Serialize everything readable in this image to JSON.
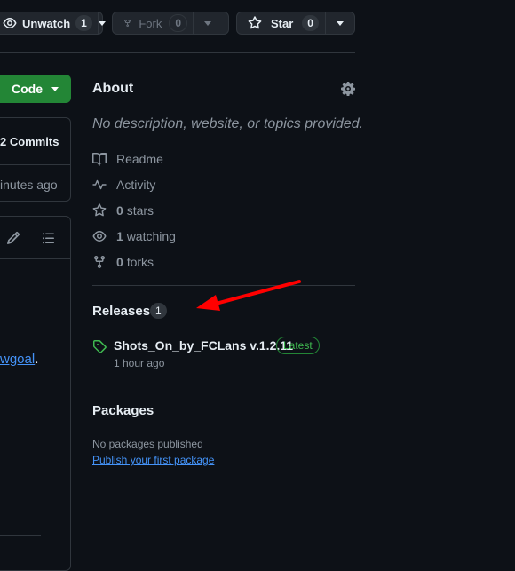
{
  "actions": {
    "unwatch": {
      "label": "Unwatch",
      "count": "1"
    },
    "fork": {
      "label": "Fork",
      "count": "0"
    },
    "star": {
      "label": "Star",
      "count": "0"
    }
  },
  "left": {
    "code_label": "Code",
    "commits_label": "2 Commits",
    "time_partial": "inutes ago",
    "link_partial": "wgoal",
    "link_suffix": "."
  },
  "about": {
    "title": "About",
    "description": "No description, website, or topics provided.",
    "stats": [
      {
        "icon": "book-icon",
        "value": "",
        "label": "Readme"
      },
      {
        "icon": "pulse-icon",
        "value": "",
        "label": "Activity"
      },
      {
        "icon": "star-icon",
        "value": "0",
        "label": "stars"
      },
      {
        "icon": "eye-icon",
        "value": "1",
        "label": "watching"
      },
      {
        "icon": "fork-icon",
        "value": "0",
        "label": "forks"
      }
    ]
  },
  "releases": {
    "title": "Releases",
    "count": "1",
    "name": "Shots_On_by_FCLans v.1.2.11",
    "badge": "Latest",
    "time": "1 hour ago"
  },
  "packages": {
    "title": "Packages",
    "empty_text": "No packages published",
    "link": "Publish your first package"
  },
  "colors": {
    "background": "#0d1117",
    "accent_green": "#238636",
    "link_blue": "#4493f8",
    "arrow_red": "#ff0000"
  }
}
